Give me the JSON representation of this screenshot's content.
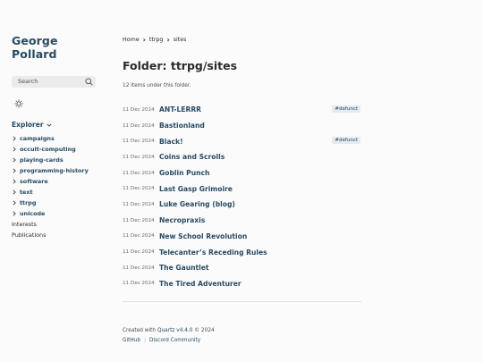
{
  "site": {
    "title": "George Pollard"
  },
  "search": {
    "label": "Search"
  },
  "explorer": {
    "heading": "Explorer",
    "folders": [
      "campaigns",
      "occult-computing",
      "playing-cards",
      "programming-history",
      "software",
      "text",
      "ttrpg",
      "unicode"
    ],
    "pages": [
      "Interests",
      "Publications"
    ]
  },
  "breadcrumb": {
    "home": "Home",
    "ttrpg": "ttrpg",
    "sites": "sites"
  },
  "page": {
    "title": "Folder: ttrpg/sites",
    "count": "12 items under this folder."
  },
  "items": [
    {
      "date": "11 Dec 2024",
      "title": "ANT-LERRR",
      "tag": "#defunct"
    },
    {
      "date": "11 Dec 2024",
      "title": "Bastionland",
      "tag": ""
    },
    {
      "date": "11 Dec 2024",
      "title": "Black!",
      "tag": "#defunct"
    },
    {
      "date": "11 Dec 2024",
      "title": "Coins and Scrolls",
      "tag": ""
    },
    {
      "date": "11 Dec 2024",
      "title": "Goblin Punch",
      "tag": ""
    },
    {
      "date": "11 Dec 2024",
      "title": "Last Gasp Grimoire",
      "tag": ""
    },
    {
      "date": "11 Dec 2024",
      "title": "Luke Gearing (blog)",
      "tag": ""
    },
    {
      "date": "11 Dec 2024",
      "title": "Necropraxis",
      "tag": ""
    },
    {
      "date": "11 Dec 2024",
      "title": "New School Revolution",
      "tag": ""
    },
    {
      "date": "11 Dec 2024",
      "title": "Telecanter’s Receding Rules",
      "tag": ""
    },
    {
      "date": "11 Dec 2024",
      "title": "The Gauntlet",
      "tag": ""
    },
    {
      "date": "11 Dec 2024",
      "title": "The Tired Adventurer",
      "tag": ""
    }
  ],
  "footer": {
    "created_prefix": "Created with",
    "brand": "Quartz v4.4.0",
    "year": "© 2024",
    "links": [
      "GitHub",
      "Discord Community"
    ]
  },
  "icons": {
    "search": "search-icon",
    "theme": "sun-icon",
    "explorer": "chevron-down-icon",
    "folder": "chevron-right-icon"
  },
  "colors": {
    "accent": "#284b63",
    "background": "#fbfbfb",
    "tag_bg": "#e6eaee"
  }
}
